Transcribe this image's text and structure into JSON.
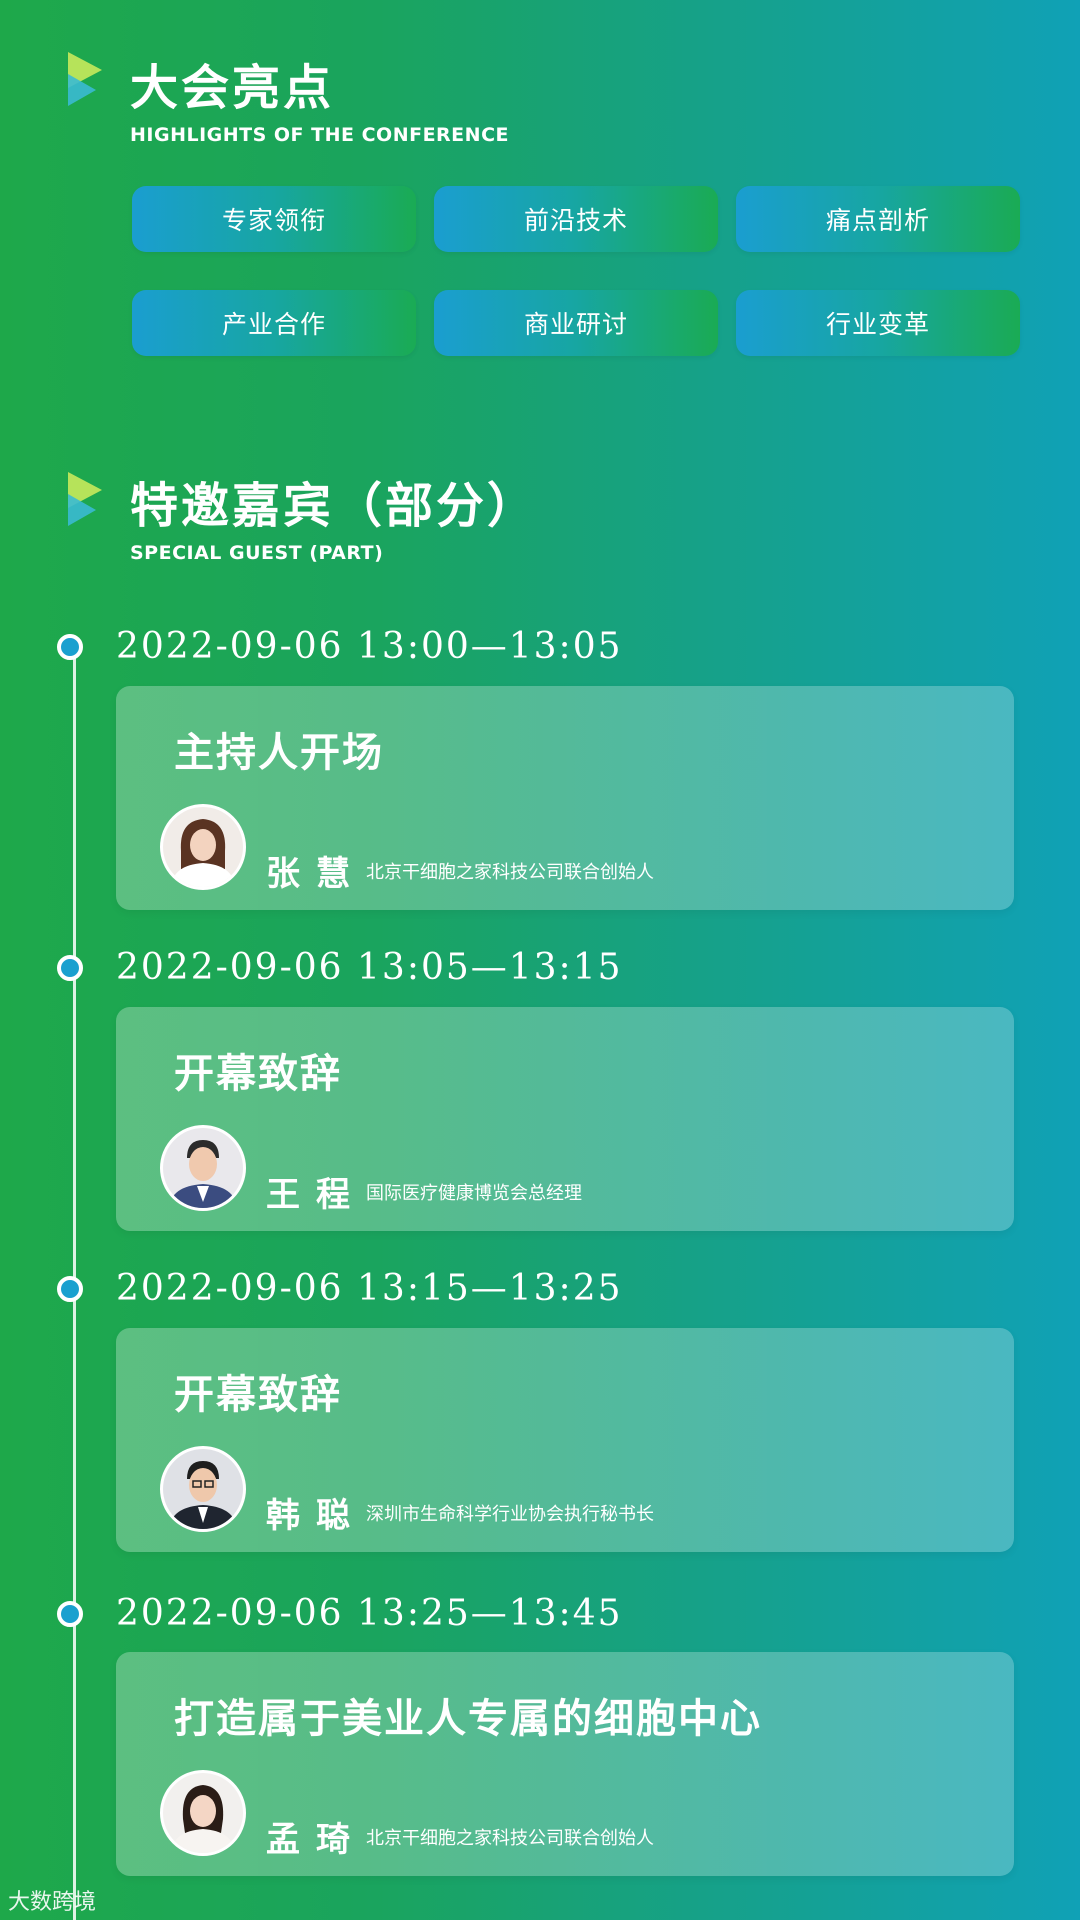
{
  "highlights": {
    "title": "大会亮点",
    "subtitle": "HIGHLIGHTS OF THE CONFERENCE",
    "items": [
      "专家领衔",
      "前沿技术",
      "痛点剖析",
      "产业合作",
      "商业研讨",
      "行业变革"
    ]
  },
  "guests": {
    "title": "特邀嘉宾（部分）",
    "subtitle": "SPECIAL GUEST (PART)"
  },
  "schedule": [
    {
      "time": "2022-09-06  13:00—13:05",
      "title": "主持人开场",
      "speaker": "张慧",
      "role": "北京干细胞之家科技公司联合创始人"
    },
    {
      "time": "2022-09-06  13:05—13:15",
      "title": "开幕致辞",
      "speaker": "王程",
      "role": "国际医疗健康博览会总经理"
    },
    {
      "time": "2022-09-06  13:15—13:25",
      "title": "开幕致辞",
      "speaker": "韩聪",
      "role": "深圳市生命科学行业协会执行秘书长"
    },
    {
      "time": "2022-09-06  13:25—13:45",
      "title": "打造属于美业人专属的细胞中心",
      "speaker": "孟琦",
      "role": "北京干细胞之家科技公司联合创始人"
    }
  ],
  "watermark": "大数跨境",
  "icons": {
    "section": "play-triangle-icon",
    "avatar": "person-photo-icon"
  },
  "colors": {
    "pill_start": "#1a9ed0",
    "pill_end": "#1aab54",
    "dot": "#1aa0cf"
  }
}
